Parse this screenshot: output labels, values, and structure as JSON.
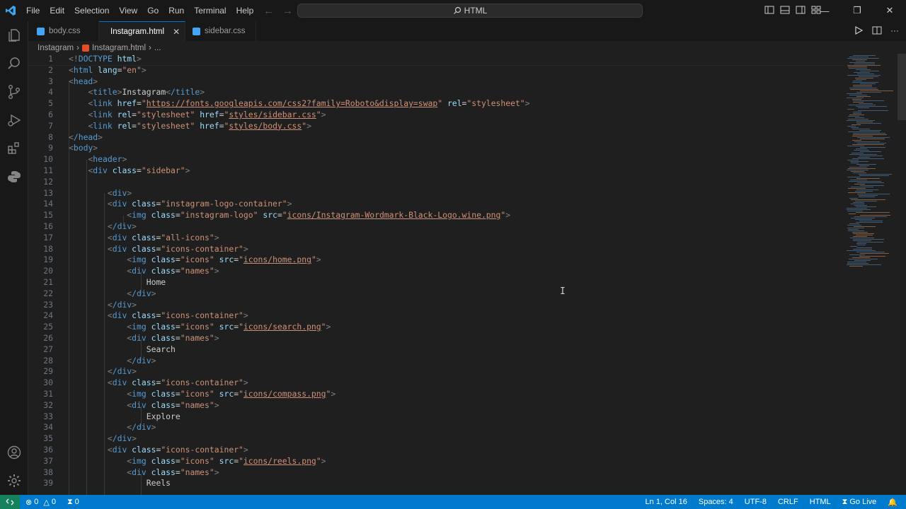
{
  "menu": [
    "File",
    "Edit",
    "Selection",
    "View",
    "Go",
    "Run",
    "Terminal",
    "Help"
  ],
  "command_center": "HTML",
  "tabs": [
    {
      "label": "body.css",
      "icon": "css-file-icon",
      "color": "#42a5f5"
    },
    {
      "label": "Instagram.html",
      "icon": "html-file-icon",
      "color": "#e44d26",
      "active": true
    },
    {
      "label": "sidebar.css",
      "icon": "css-file-icon",
      "color": "#42a5f5"
    }
  ],
  "breadcrumb": {
    "folder": "Instagram",
    "file": "Instagram.html",
    "more": "..."
  },
  "line_numbers": [
    "1",
    "2",
    "3",
    "4",
    "5",
    "6",
    "7",
    "8",
    "9",
    "10",
    "11",
    "12",
    "13",
    "14",
    "15",
    "16",
    "17",
    "18",
    "19",
    "20",
    "21",
    "22",
    "23",
    "24",
    "25",
    "26",
    "27",
    "28",
    "29",
    "30",
    "31",
    "32",
    "33",
    "34",
    "35",
    "36",
    "37",
    "38",
    "39"
  ],
  "code": {
    "l1a": "<!",
    "l1b": "DOCTYPE",
    "l1c": " html",
    "l1d": ">",
    "l2a": "html",
    "l2b": "lang",
    "l2c": "\"en\"",
    "l3": "head",
    "l4a": "title",
    "l4b": "Instagram",
    "l4c": "/title",
    "l5a": "link",
    "l5b": "href",
    "l5c": "https://fonts.googleapis.com/css2?family=Roboto&display=swap",
    "l5d": "rel",
    "l5e": "\"stylesheet\"",
    "l6a": "link",
    "l6b": "rel",
    "l6c": "\"stylesheet\"",
    "l6d": "href",
    "l6e": "styles/sidebar.css",
    "l7a": "link",
    "l7b": "rel",
    "l7c": "\"stylesheet\"",
    "l7d": "href",
    "l7e": "styles/body.css",
    "l8": "/head",
    "l9": "body",
    "l10": "header",
    "l11a": "div",
    "l11b": "class",
    "l11c": "\"sidebar\"",
    "l13": "div",
    "l14a": "div",
    "l14b": "class",
    "l14c": "\"instagram-logo-container\"",
    "l15a": "img",
    "l15b": "class",
    "l15c": "\"instagram-logo\"",
    "l15d": "src",
    "l15e": "icons/Instagram-Wordmark-Black-Logo.wine.png",
    "l16": "/div",
    "l17a": "div",
    "l17b": "class",
    "l17c": "\"all-icons\"",
    "l18a": "div",
    "l18b": "class",
    "l18c": "\"icons-container\"",
    "l19a": "img",
    "l19b": "class",
    "l19c": "\"icons\"",
    "l19d": "src",
    "l19e": "icons/home.png",
    "l20a": "div",
    "l20b": "class",
    "l20c": "\"names\"",
    "l21": "Home",
    "l22": "/div",
    "l23": "/div",
    "l24a": "div",
    "l24b": "class",
    "l24c": "\"icons-container\"",
    "l25a": "img",
    "l25b": "class",
    "l25c": "\"icons\"",
    "l25d": "src",
    "l25e": "icons/search.png",
    "l26a": "div",
    "l26b": "class",
    "l26c": "\"names\"",
    "l27": "Search",
    "l28": "/div",
    "l29": "/div",
    "l30a": "div",
    "l30b": "class",
    "l30c": "\"icons-container\"",
    "l31a": "img",
    "l31b": "class",
    "l31c": "\"icons\"",
    "l31d": "src",
    "l31e": "icons/compass.png",
    "l32a": "div",
    "l32b": "class",
    "l32c": "\"names\"",
    "l33": "Explore",
    "l34": "/div",
    "l35": "/div",
    "l36a": "div",
    "l36b": "class",
    "l36c": "\"icons-container\"",
    "l37a": "img",
    "l37b": "class",
    "l37c": "\"icons\"",
    "l37d": "src",
    "l37e": "icons/reels.png",
    "l38a": "div",
    "l38b": "class",
    "l38c": "\"names\"",
    "l39": "Reels"
  },
  "status": {
    "errors": "0",
    "warnings": "0",
    "ports": "0",
    "position": "Ln 1, Col 16",
    "spaces": "Spaces: 4",
    "encoding": "UTF-8",
    "eol": "CRLF",
    "language": "HTML",
    "golive": "Go Live"
  },
  "colors": {
    "accent": "#0078d4",
    "statusbar": "#007acc",
    "editor_bg": "#1f1f1f",
    "tag": "#569cd6",
    "attr": "#9cdcfe",
    "string": "#ce9178"
  }
}
